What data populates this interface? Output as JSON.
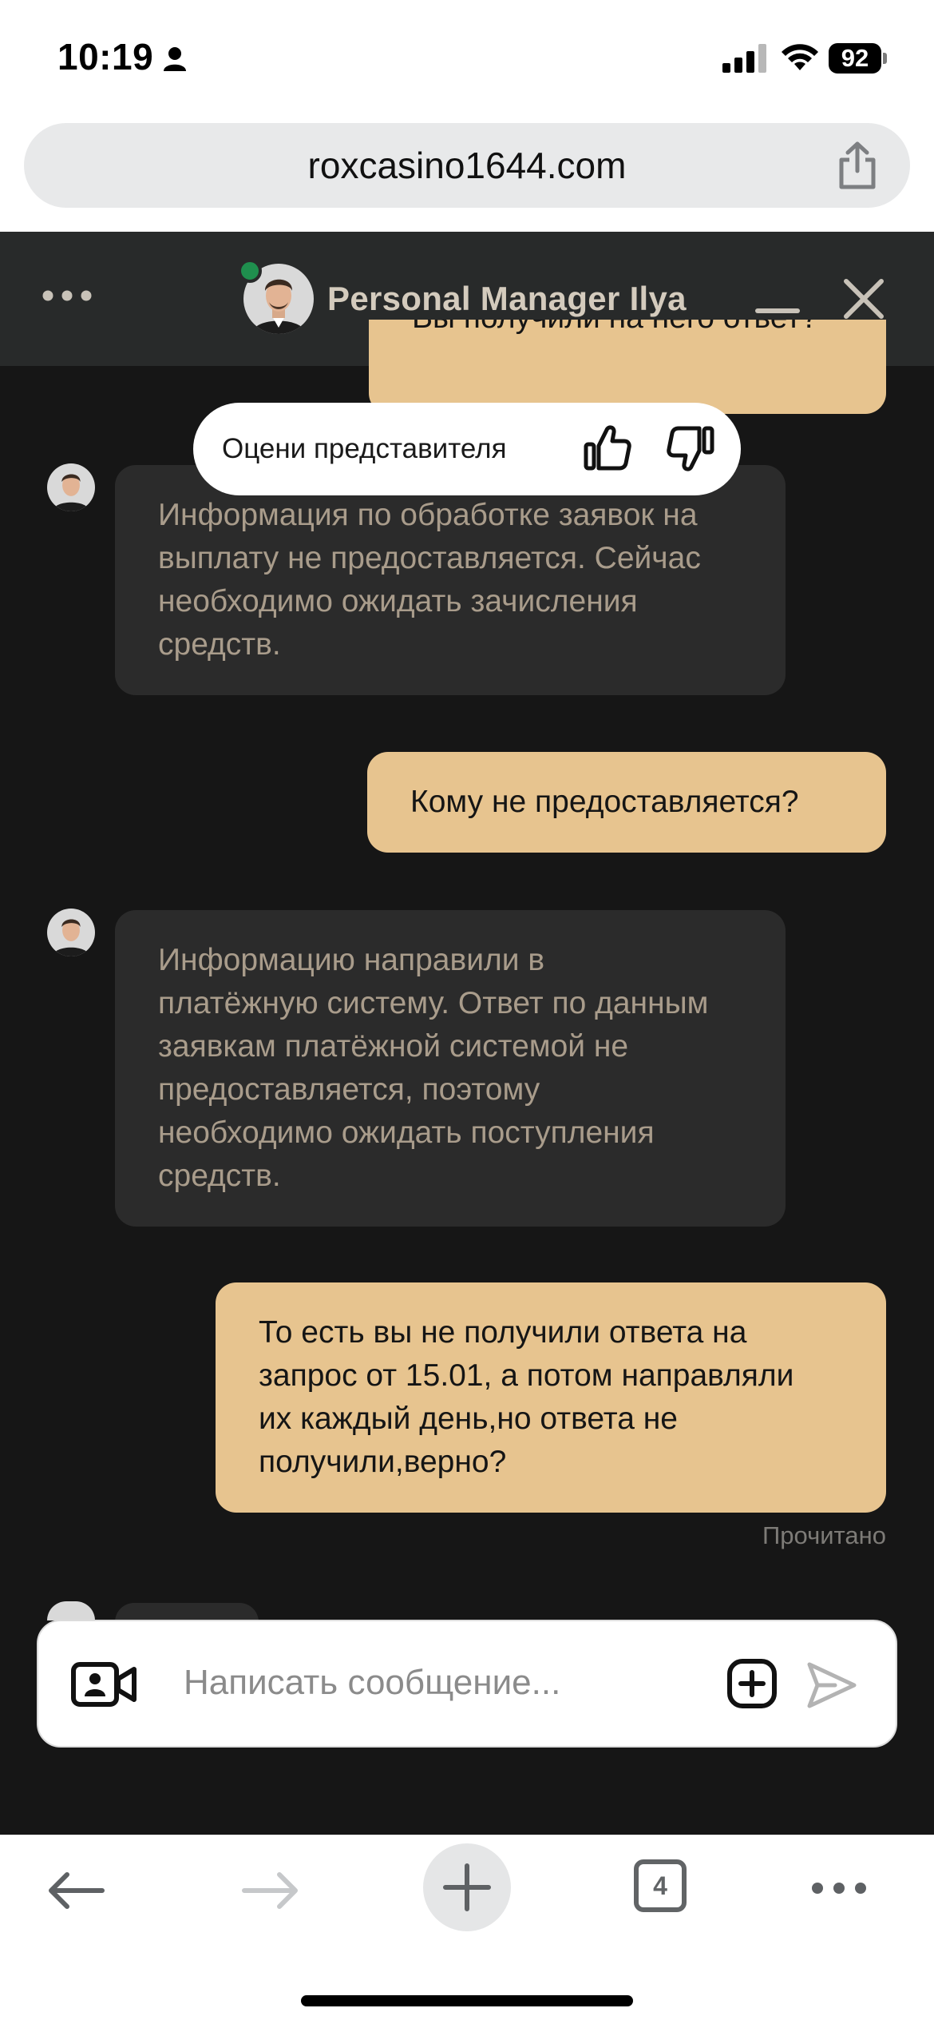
{
  "status_bar": {
    "time": "10:19",
    "battery": "92"
  },
  "browser": {
    "url": "roxcasino1644.com",
    "tab_count": "4"
  },
  "chat": {
    "title": "Personal Manager Ilya",
    "partial_top_message": "Вы получили на него ответ?",
    "rating_prompt": "Оцени представителя",
    "messages": [
      {
        "from": "manager",
        "text": "Информация по обработке заявок на выплату не предоставляется. Сейчас необходимо ожидать зачисления средств."
      },
      {
        "from": "user",
        "text": "Кому не предоставляется?"
      },
      {
        "from": "manager",
        "text": "Информацию направили в платёжную систему. Ответ по данным заявкам платёжной системой не предоставляется, поэтому необходимо ожидать поступления средств."
      },
      {
        "from": "user",
        "text": "То есть вы не получили ответа на запрос от 15.01, а потом направляли их каждый день,но ответа не получили,верно?"
      }
    ],
    "read_status": "Прочитано",
    "composer_placeholder": "Написать сообщение..."
  },
  "colors": {
    "chat_background": "#161616",
    "header_background": "#282a2a",
    "manager_bubble": "#2b2b2b",
    "user_bubble": "#e7c48f",
    "online_dot": "#1f8f4e"
  },
  "icons": [
    "person-icon",
    "signal-icon",
    "wifi-icon",
    "battery-icon",
    "share-icon",
    "more-dots-icon",
    "minimize-icon",
    "close-icon",
    "thumbs-up-icon",
    "thumbs-down-icon",
    "video-call-icon",
    "attach-plus-icon",
    "send-icon",
    "back-arrow-icon",
    "forward-arrow-icon",
    "new-tab-plus-icon",
    "tabs-icon"
  ]
}
